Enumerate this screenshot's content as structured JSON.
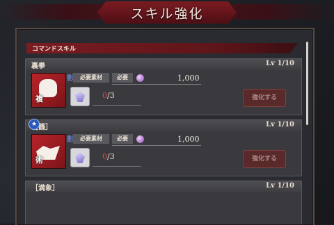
{
  "header": {
    "title": "スキル強化"
  },
  "section": {
    "label": "コマンドスキル"
  },
  "skills": [
    {
      "name": "裏拳",
      "level": "Lv 1/10",
      "tag_kanji": "複",
      "tag_shadow": "影",
      "material_label": "必要素材",
      "required_label": "必要",
      "cost": "1,000",
      "have": "0",
      "need": "/3",
      "button": "強化する"
    },
    {
      "name": "［鶴］",
      "level": "Lv 1/10",
      "tag_kanji": "術",
      "tag_shadow": "影",
      "material_label": "必要素材",
      "required_label": "必要",
      "cost": "1,000",
      "have": "0",
      "need": "/3",
      "button": "強化する"
    },
    {
      "name": "［満象］",
      "level": "Lv 1/10"
    }
  ],
  "colors": {
    "accent_red": "#7a1c22",
    "count_red": "#e04848"
  }
}
